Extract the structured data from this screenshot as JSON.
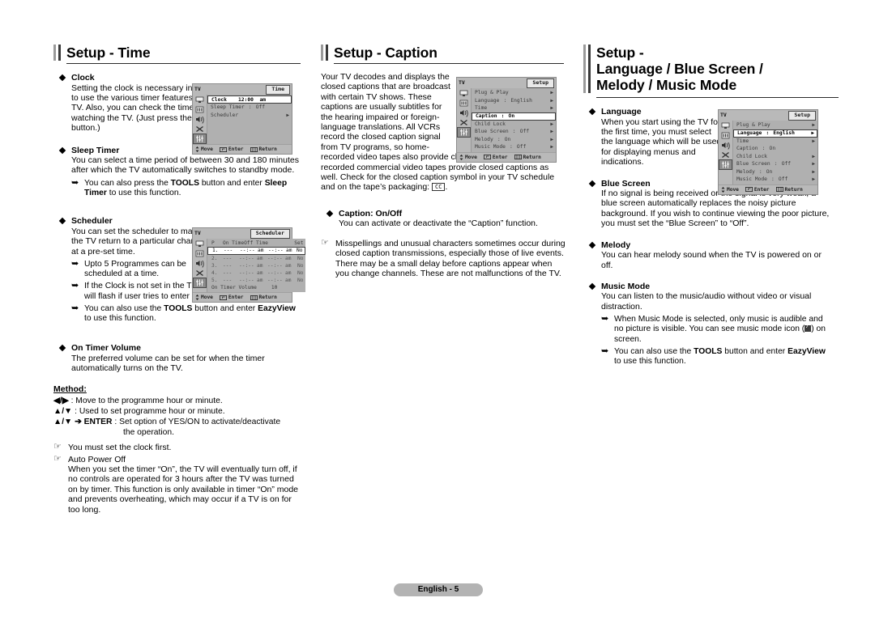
{
  "page": {
    "footer_label": "English - 5"
  },
  "columns": {
    "left": {
      "heading": "Setup - Time",
      "sections": [
        {
          "title": "Clock",
          "body": "Setting the clock is necessary in order to use the various timer features of the TV. Also, you can check the time while watching the TV. (Just press the INFO button.)"
        },
        {
          "title": "Sleep Timer",
          "body": "You can select a time period of between 30 and 180 minutes after which the TV automatically switches to standby mode.",
          "notes": [
            "You can also press the TOOLS button and enter Sleep Timer to use this function."
          ]
        },
        {
          "title": "Scheduler",
          "body": "You can set the scheduler to make the TV return to a particular channel at a pre-set time.",
          "notes": [
            "Upto 5 Programmes can be scheduled at a time.",
            "If the Clock is not set in the Time menu, a pop-up warning will flash if user tries to enter Scheduler.",
            "You can also use the TOOLS button and enter EazyView to use this function."
          ]
        },
        {
          "title": "On Timer Volume",
          "body": "The preferred volume can be set for when the timer automatically turns on the TV."
        }
      ],
      "method": {
        "title": "Method:",
        "rows": [
          {
            "keys": "◀/▶",
            "text": ": Move to the programme hour or minute."
          },
          {
            "keys": "▲/▼",
            "text": ": Used to set programme hour or minute."
          },
          {
            "keys": "▲/▼ ➔ ENTER",
            "text": ": Set option of YES/ON to activate/deactivate"
          }
        ],
        "continuation": "the operation."
      },
      "hand_notes": [
        "You must set the clock first.",
        "Auto Power Off"
      ],
      "auto_power_off_body": "When you set the timer “On”, the TV will eventually turn off, if no controls are operated for 3 hours after the TV was turned on by timer. This function is only available in timer “On” mode and prevents overheating, which may occur if a TV is on for too long."
    },
    "mid": {
      "heading": "Setup - Caption",
      "intro_wrap": "Your TV decodes and displays the closed captions that are broadcast with certain TV shows. These captions are usually subtitles for the hearing impaired or foreign-language translations. All VCRs record the closed caption signal from TV programs, so home-",
      "intro_full": "recorded video tapes also provide closed captions. Most pre-recorded commercial video tapes provide closed captions as well. Check for the closed caption symbol in your TV schedule and on the tape’s packaging:",
      "cc_symbol": "CC",
      "sections": [
        {
          "title": "Caption: On/Off",
          "body": "You can activate or deactivate the “Caption” function."
        }
      ],
      "hand_notes": [
        "Misspellings and unusual characters sometimes occur during closed caption transmissions, especially those of live events. There may be a small delay before captions appear when you change channels. These are not malfunctions of the TV."
      ]
    },
    "right": {
      "heading": "Setup -\nLanguage / Blue Screen /\nMelody / Music Mode",
      "sections": [
        {
          "title": "Language",
          "body": "When you start using the TV for the first time, you must select the language which will be used for displaying menus and indications."
        },
        {
          "title": "Blue Screen",
          "body": "If no signal is being received or the signal is very weak, a blue screen automatically replaces the noisy picture background. If you wish to continue viewing the poor picture, you must set the “Blue Screen” to “Off”."
        },
        {
          "title": "Melody",
          "body": "You can hear melody sound when the TV is powered on or off."
        },
        {
          "title": "Music Mode",
          "body": "You can listen to the music/audio without video or visual distraction.",
          "notes": [
            "When Music Mode is selected, only music is audible and no picture is visible. You can see music mode icon (   ) on screen.",
            "You can also use the TOOLS button and enter EazyView to use this function."
          ]
        }
      ]
    }
  },
  "osd_menus": {
    "time": {
      "tv_label": "TV",
      "tag": "Time",
      "rows": [
        {
          "label": "Clock",
          "sep": "",
          "value": "12:00  am",
          "arrow": "",
          "highlight": true
        },
        {
          "label": "Sleep Timer",
          "sep": ":",
          "value": "Off",
          "arrow": "",
          "highlight": false
        },
        {
          "label": "Scheduler",
          "sep": "",
          "value": "",
          "arrow": "▶",
          "highlight": false
        }
      ],
      "footer": {
        "move": "Move",
        "enter": "Enter",
        "return": "Return"
      }
    },
    "scheduler": {
      "tv_label": "TV",
      "tag": "Scheduler",
      "headers": [
        "P",
        "On Time",
        "",
        "Off Time",
        "",
        "Set"
      ],
      "rows": [
        {
          "n": "1.",
          "ch": "---",
          "on": "--:--",
          "onap": "am",
          "off": "--:--",
          "offap": "am",
          "set": "No",
          "highlight": true
        },
        {
          "n": "2.",
          "ch": "---",
          "on": "--:--",
          "onap": "am",
          "off": "--:--",
          "offap": "am",
          "set": "No",
          "highlight": false
        },
        {
          "n": "3.",
          "ch": "---",
          "on": "--:--",
          "onap": "am",
          "off": "--:--",
          "offap": "am",
          "set": "No",
          "highlight": false
        },
        {
          "n": "4.",
          "ch": "---",
          "on": "--:--",
          "onap": "am",
          "off": "--:--",
          "offap": "am",
          "set": "No",
          "highlight": false
        },
        {
          "n": "5.",
          "ch": "---",
          "on": "--:--",
          "onap": "am",
          "off": "--:--",
          "offap": "am",
          "set": "No",
          "highlight": false
        }
      ],
      "volume_label": "On Timer Volume",
      "volume_value": "10",
      "footer": {
        "move": "Move",
        "enter": "Enter",
        "return": "Return"
      }
    },
    "setup_caption": {
      "tv_label": "TV",
      "tag": "Setup",
      "rows": [
        {
          "label": "Plug & Play",
          "sep": "",
          "value": "",
          "arrow": "▶",
          "highlight": false
        },
        {
          "label": "Language",
          "sep": ":",
          "value": "English",
          "arrow": "▶",
          "highlight": false
        },
        {
          "label": "Time",
          "sep": "",
          "value": "",
          "arrow": "▶",
          "highlight": false
        },
        {
          "label": "Caption",
          "sep": ":",
          "value": "On",
          "arrow": "",
          "highlight": true
        },
        {
          "label": "Child Lock",
          "sep": "",
          "value": "",
          "arrow": "▶",
          "highlight": false
        },
        {
          "label": "Blue Screen",
          "sep": ":",
          "value": "Off",
          "arrow": "▶",
          "highlight": false
        },
        {
          "label": "Melody",
          "sep": ":",
          "value": "On",
          "arrow": "▶",
          "highlight": false
        },
        {
          "label": "Music Mode",
          "sep": ":",
          "value": "Off",
          "arrow": "▶",
          "highlight": false
        }
      ],
      "footer": {
        "move": "Move",
        "enter": "Enter",
        "return": "Return"
      }
    },
    "setup_language": {
      "tv_label": "TV",
      "tag": "Setup",
      "rows": [
        {
          "label": "Plug & Play",
          "sep": "",
          "value": "",
          "arrow": "▶",
          "highlight": false
        },
        {
          "label": "Language",
          "sep": ":",
          "value": "English",
          "arrow": "▶",
          "highlight": true
        },
        {
          "label": "Time",
          "sep": "",
          "value": "",
          "arrow": "▶",
          "highlight": false
        },
        {
          "label": "Caption",
          "sep": ":",
          "value": "On",
          "arrow": "",
          "highlight": false
        },
        {
          "label": "Child Lock",
          "sep": "",
          "value": "",
          "arrow": "▶",
          "highlight": false
        },
        {
          "label": "Blue Screen",
          "sep": ":",
          "value": "Off",
          "arrow": "▶",
          "highlight": false
        },
        {
          "label": "Melody",
          "sep": ":",
          "value": "On",
          "arrow": "▶",
          "highlight": false
        },
        {
          "label": "Music Mode",
          "sep": ":",
          "value": "Off",
          "arrow": "▶",
          "highlight": false
        }
      ],
      "footer": {
        "move": "Move",
        "enter": "Enter",
        "return": "Return"
      }
    }
  },
  "colors": {
    "osd_background": "#b9b9b9",
    "osd_rows": "#b0b0b0",
    "highlight": "#ffffff",
    "footer_pill": "#b3b3b3",
    "heading_rule": "#2a2a2a"
  }
}
